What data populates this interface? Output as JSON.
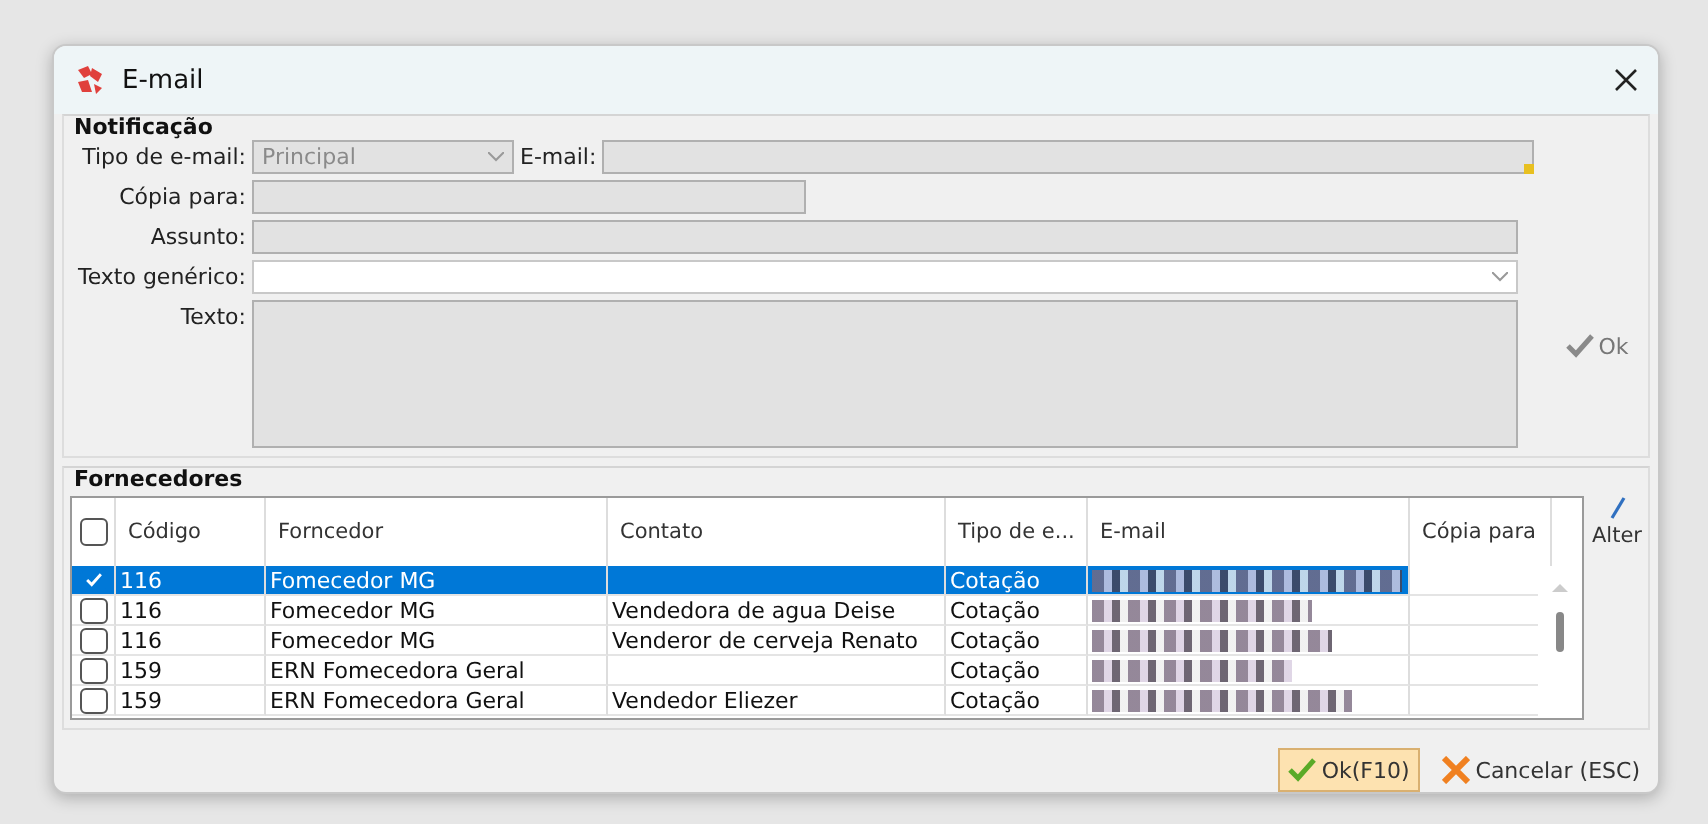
{
  "window": {
    "title": "E-mail"
  },
  "notification": {
    "title": "Notificação",
    "fields": [
      {
        "label": "Tipo de e-mail:",
        "kind": "combo",
        "value": "Principal",
        "disabled": true
      },
      {
        "label": "E-mail:",
        "kind": "text",
        "disabled": true
      },
      {
        "label": "Cópia para:",
        "kind": "text",
        "disabled": true
      },
      {
        "label": "Assunto:",
        "kind": "text",
        "disabled": true
      },
      {
        "label": "Texto genérico:",
        "kind": "combo",
        "disabled": false
      },
      {
        "label": "Texto:",
        "kind": "area",
        "disabled": true
      }
    ],
    "ok_button": "Ok"
  },
  "suppliers": {
    "title": "Fornecedores",
    "header_checked": false,
    "columns": [
      "Código",
      "Forncedor",
      "Contato",
      "Tipo de e...",
      "E-mail",
      "Cópia para"
    ],
    "rows": [
      {
        "checked": true,
        "selected": true,
        "cells": [
          "116",
          "Fomecedor MG",
          "",
          "Cotação"
        ]
      },
      {
        "checked": false,
        "selected": false,
        "cells": [
          "116",
          "Fomecedor MG",
          "Vendedora de agua Deise",
          "Cotação"
        ]
      },
      {
        "checked": false,
        "selected": false,
        "cells": [
          "116",
          "Fomecedor MG",
          "Venderor de cerveja Renato",
          "Cotação"
        ]
      },
      {
        "checked": false,
        "selected": false,
        "cells": [
          "159",
          "ERN Fomecedora Geral",
          "",
          "Cotação"
        ]
      },
      {
        "checked": false,
        "selected": false,
        "cells": [
          "159",
          "ERN Fomecedora Geral",
          "Vendedor Eliezer",
          "Cotação"
        ]
      }
    ],
    "side_button": "Alter"
  },
  "buttons": [
    {
      "label": "Ok(F10)",
      "kind": "ok",
      "focused": true
    },
    {
      "label": "Cancelar (ESC)",
      "kind": "cancel",
      "focused": false
    }
  ]
}
